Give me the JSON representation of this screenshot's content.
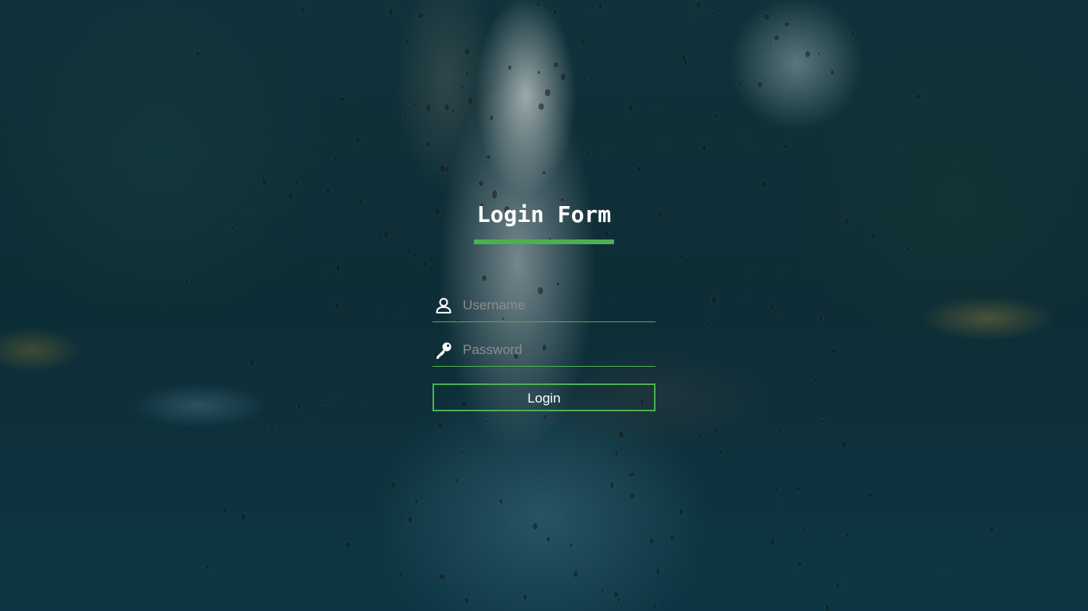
{
  "login_form": {
    "title": "Login Form",
    "username": {
      "placeholder": "Username",
      "value": "",
      "icon": "user-icon"
    },
    "password": {
      "placeholder": "Password",
      "value": "",
      "icon": "key-icon"
    },
    "submit_label": "Login"
  },
  "colors": {
    "accent": "#4caf50",
    "text": "#ffffff",
    "placeholder": "#8c8c8c"
  },
  "background": {
    "icon": "rainy-city-street-photo"
  }
}
